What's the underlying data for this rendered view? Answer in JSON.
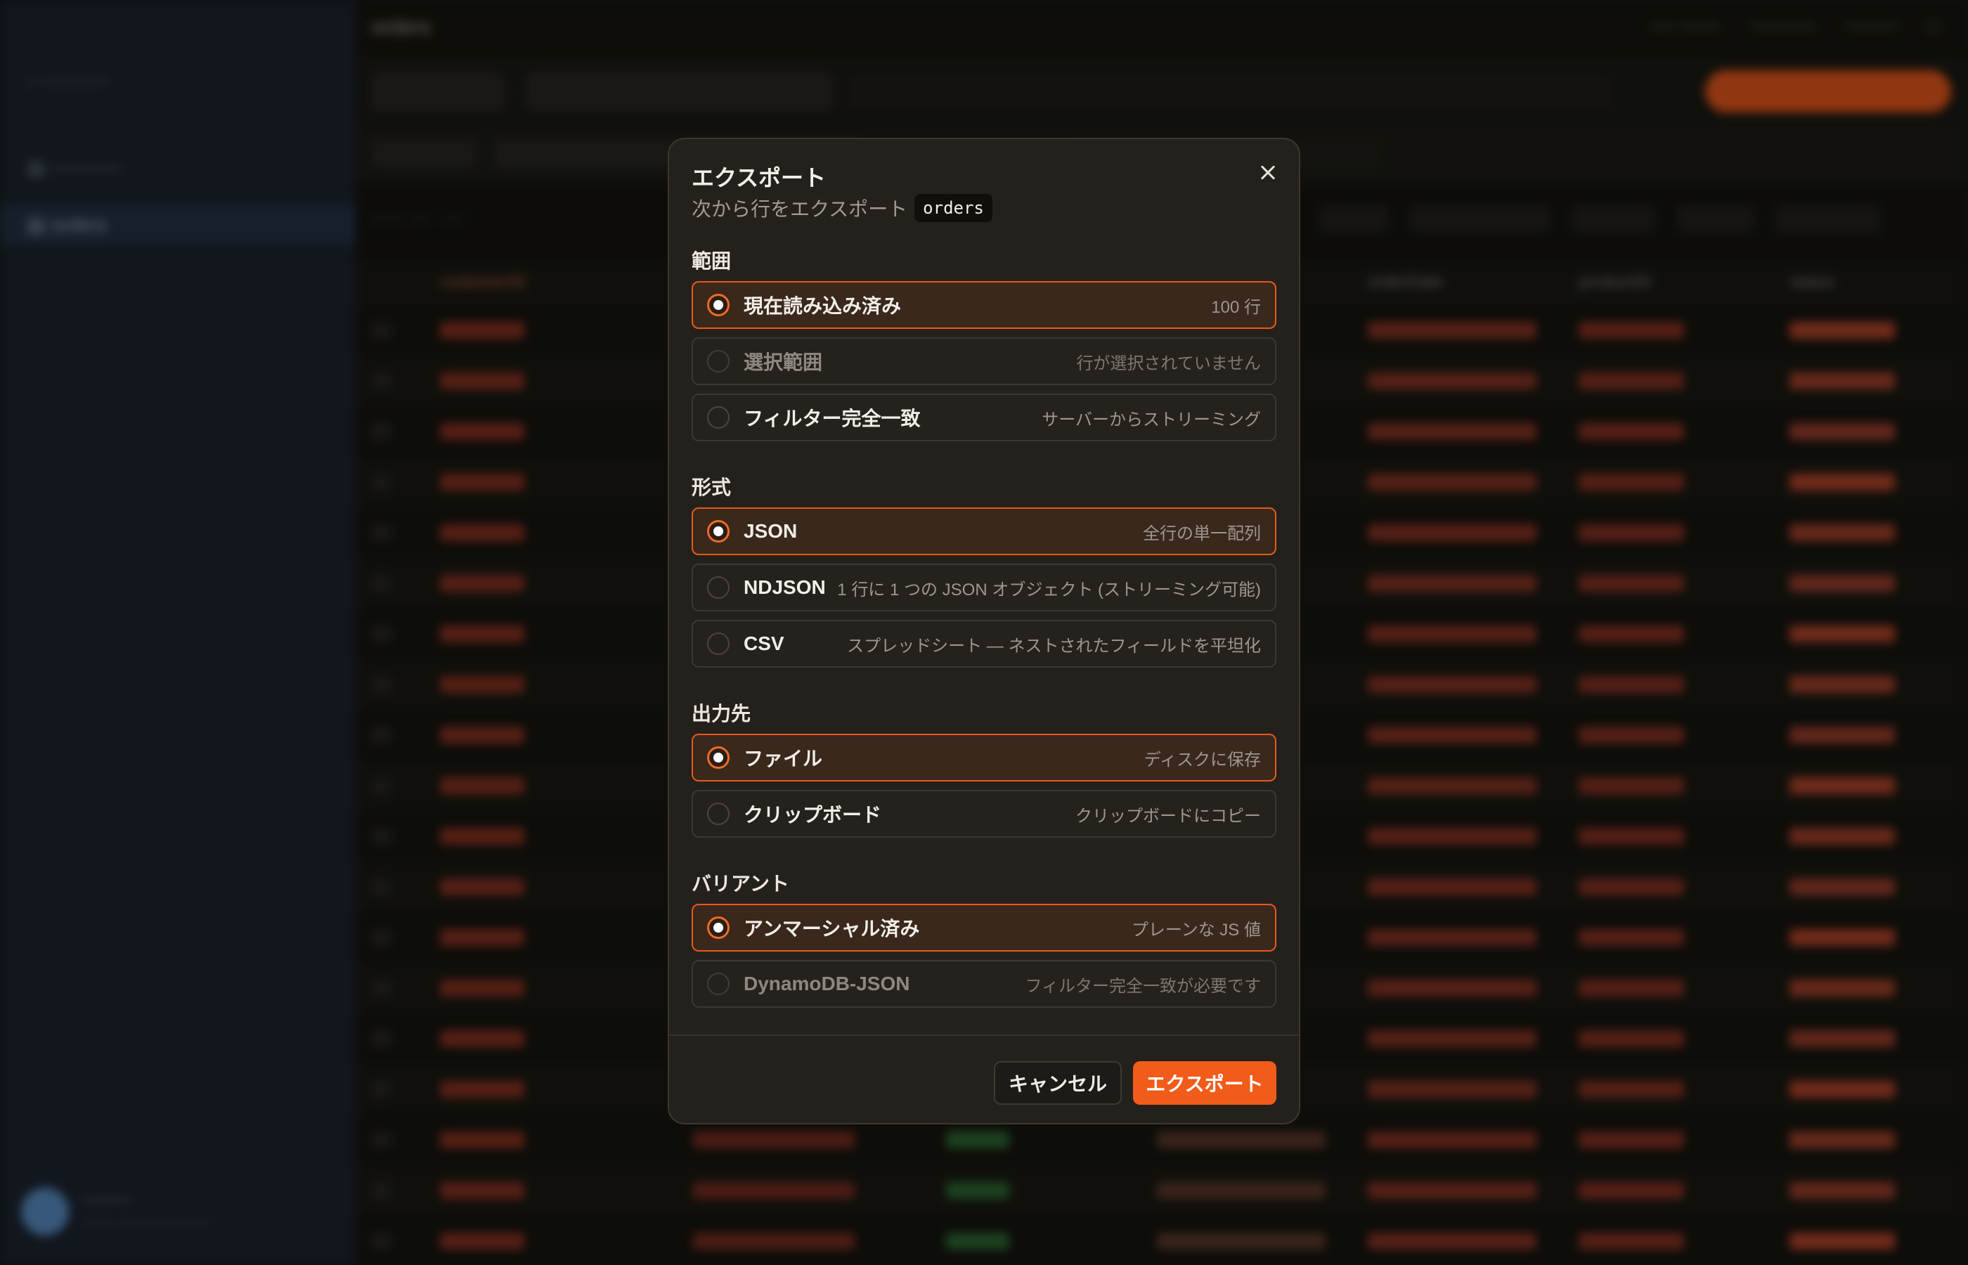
{
  "background": {
    "table_name": "orders",
    "first_column_header": "customerID",
    "other_headers": [
      "orderDate",
      "productID",
      "status"
    ]
  },
  "modal": {
    "title": "エクスポート",
    "subtitle": "次から行をエクスポート",
    "table_code": "orders",
    "sections": {
      "scope": {
        "label": "範囲",
        "options": [
          {
            "label": "現在読み込み済み",
            "desc": "100 行"
          },
          {
            "label": "選択範囲",
            "desc": "行が選択されていません"
          },
          {
            "label": "フィルター完全一致",
            "desc": "サーバーからストリーミング"
          }
        ]
      },
      "format": {
        "label": "形式",
        "options": [
          {
            "label": "JSON",
            "desc": "全行の単一配列"
          },
          {
            "label": "NDJSON",
            "desc": "1 行に 1 つの JSON オブジェクト (ストリーミング可能)"
          },
          {
            "label": "CSV",
            "desc": "スプレッドシート — ネストされたフィールドを平坦化"
          }
        ]
      },
      "destination": {
        "label": "出力先",
        "options": [
          {
            "label": "ファイル",
            "desc": "ディスクに保存"
          },
          {
            "label": "クリップボード",
            "desc": "クリップボードにコピー"
          }
        ]
      },
      "variant": {
        "label": "バリアント",
        "options": [
          {
            "label": "アンマーシャル済み",
            "desc": "プレーンな JS 値"
          },
          {
            "label": "DynamoDB-JSON",
            "desc": "フィルター完全一致が必要です"
          }
        ]
      }
    },
    "selected": {
      "scope": 0,
      "format": 0,
      "destination": 0,
      "variant": 0
    },
    "buttons": {
      "cancel": "キャンセル",
      "export": "エクスポート"
    }
  },
  "colors": {
    "accent": "#f15c1a",
    "modal_bg": "#24211c",
    "selected_bg": "#3a281c"
  }
}
